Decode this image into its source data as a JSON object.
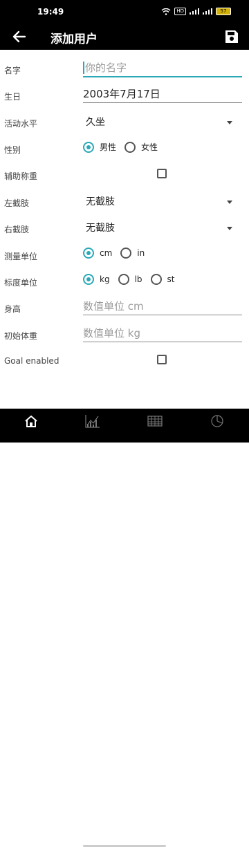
{
  "status_bar": {
    "time": "19:49",
    "hd": "HD",
    "battery": "57"
  },
  "toolbar": {
    "title": "添加用户"
  },
  "form": {
    "name": {
      "label": "名字",
      "placeholder": "你的名字"
    },
    "birthday": {
      "label": "生日",
      "value": "2003年7月17日"
    },
    "activity": {
      "label": "活动水平",
      "value": "久坐"
    },
    "gender": {
      "label": "性别",
      "options": [
        "男性",
        "女性"
      ],
      "selected": "男性"
    },
    "assisted_weighing": {
      "label": "辅助称重",
      "checked": false
    },
    "left_amputation": {
      "label": "左截肢",
      "value": "无截肢"
    },
    "right_amputation": {
      "label": "右截肢",
      "value": "无截肢"
    },
    "measure_unit": {
      "label": "测量单位",
      "options": [
        "cm",
        "in"
      ],
      "selected": "cm"
    },
    "scale_unit": {
      "label": "标度单位",
      "options": [
        "kg",
        "lb",
        "st"
      ],
      "selected": "kg"
    },
    "height": {
      "label": "身高",
      "placeholder": "数值单位 cm"
    },
    "initial_weight": {
      "label": "初始体重",
      "placeholder": "数值单位 kg"
    },
    "goal_enabled": {
      "label": "Goal enabled",
      "checked": false
    }
  },
  "colors": {
    "accent": "#2aa8b8",
    "toolbar": "#000000"
  },
  "bottom_nav": [
    "home-icon",
    "statistics-icon",
    "table-icon",
    "pie-chart-icon"
  ]
}
